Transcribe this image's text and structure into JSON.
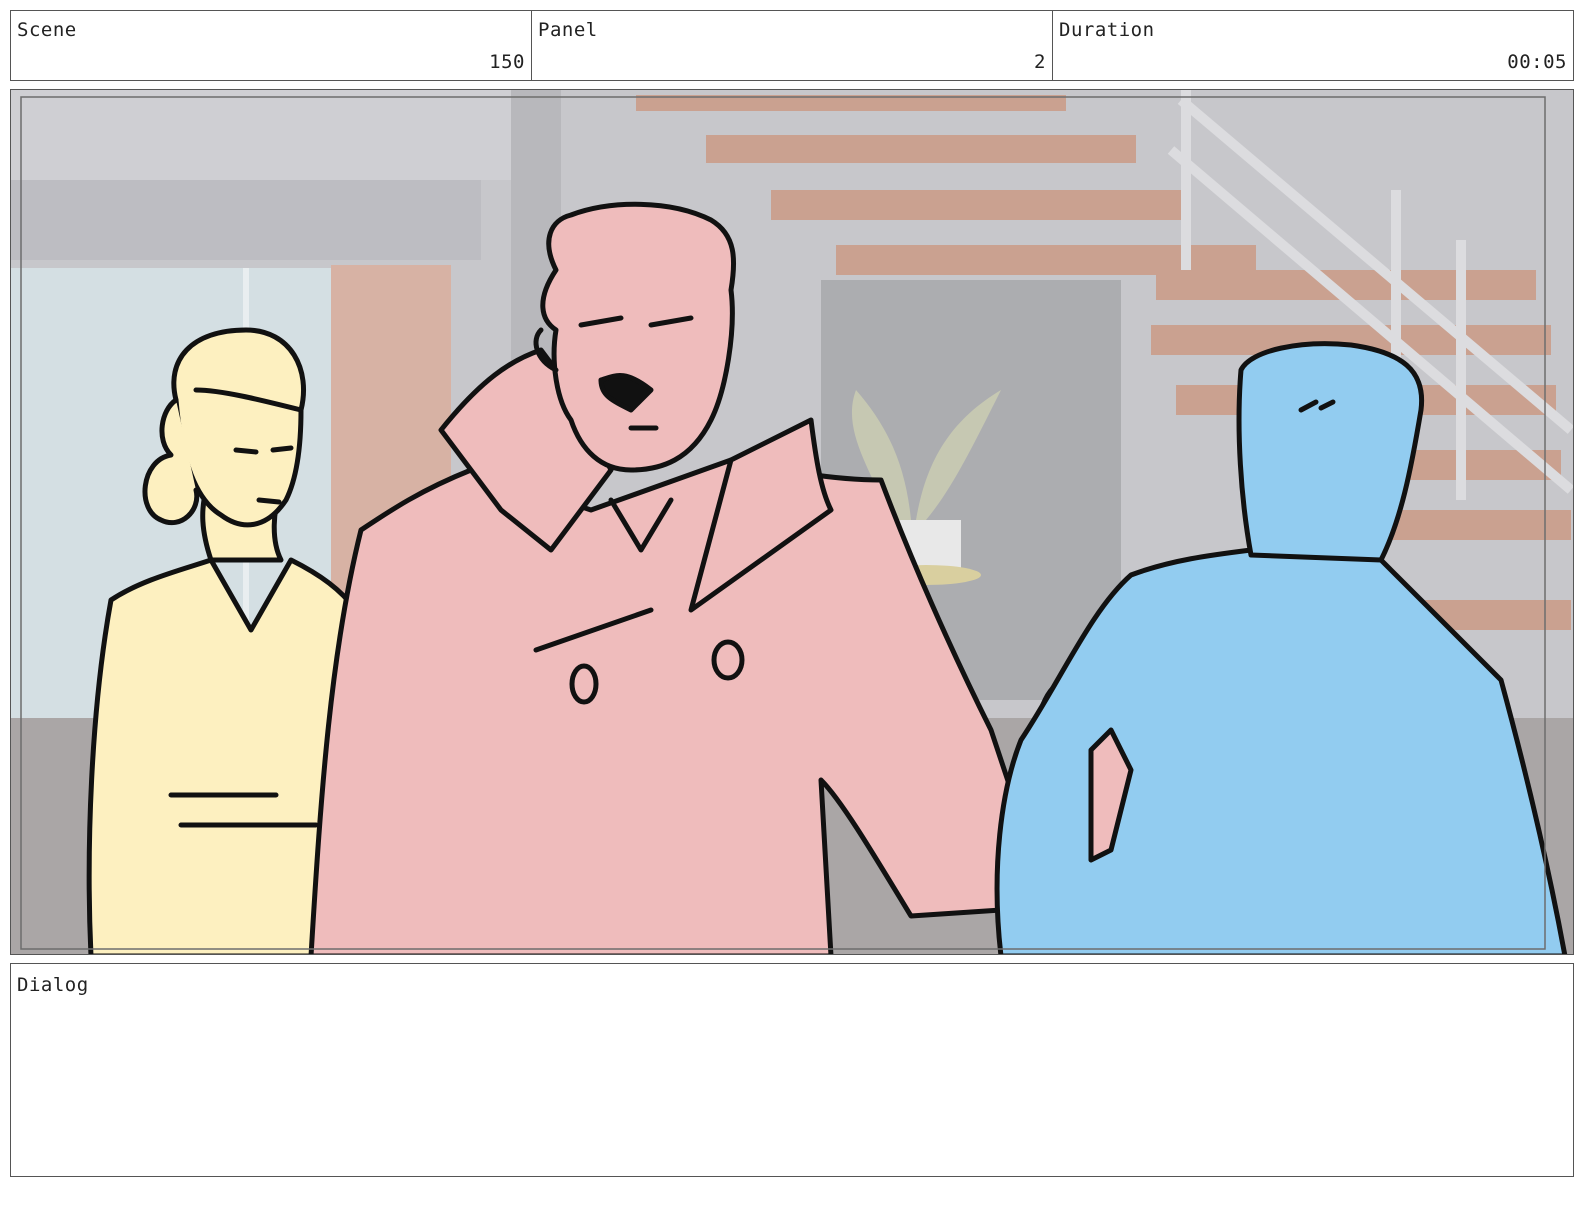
{
  "header": {
    "scene": {
      "label": "Scene",
      "value": "150"
    },
    "panel": {
      "label": "Panel",
      "value": "2"
    },
    "duration": {
      "label": "Duration",
      "value": "00:05"
    }
  },
  "frame": {
    "characters": [
      {
        "name": "woman",
        "fill": "#fdf0c0"
      },
      {
        "name": "man-trench-coat",
        "fill": "#efbcbc"
      },
      {
        "name": "man-back-view",
        "fill": "#92ccf0"
      }
    ],
    "background_colors": {
      "wall": "#c7c7cb",
      "stairs": "#caa190",
      "window": "#d4dfe3"
    }
  },
  "dialog": {
    "label": "Dialog",
    "text": ""
  }
}
